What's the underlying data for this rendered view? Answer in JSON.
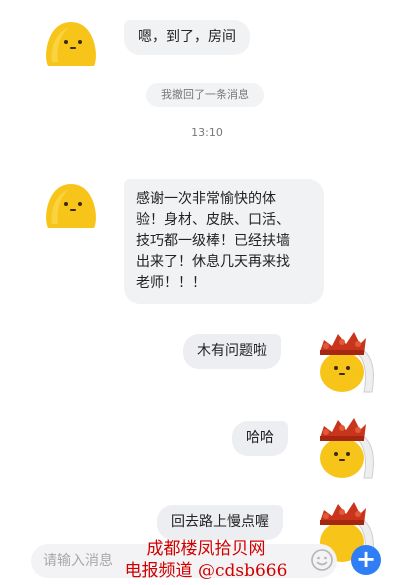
{
  "messages": [
    {
      "side": "left",
      "text": "嗯，到了，房间"
    },
    {
      "type": "notice",
      "text": "我撤回了一条消息"
    },
    {
      "type": "time",
      "text": "13:10"
    },
    {
      "side": "left",
      "text": "感谢一次非常愉快的体\n验！身材、皮肤、口活、\n技巧都一级棒！已经扶墙\n出来了！休息几天再来找\n老师！！！"
    },
    {
      "side": "right",
      "text": "木有问题啦"
    },
    {
      "side": "right",
      "text": "哈哈"
    },
    {
      "side": "right",
      "text": "回去路上慢点喔"
    }
  ],
  "input": {
    "placeholder": "请输入消息"
  },
  "icons": {
    "emoji": "emoji-face-icon",
    "plus": "plus-icon"
  },
  "colors": {
    "accent": "#2f7ef5",
    "avatar_yellow": "#f7c51a",
    "bubble_gray": "#f1f2f4",
    "watermark_red": "#d00000"
  },
  "watermark": {
    "line1": "成都楼凤拾贝网",
    "line2": "电报频道 @cdsb666"
  }
}
